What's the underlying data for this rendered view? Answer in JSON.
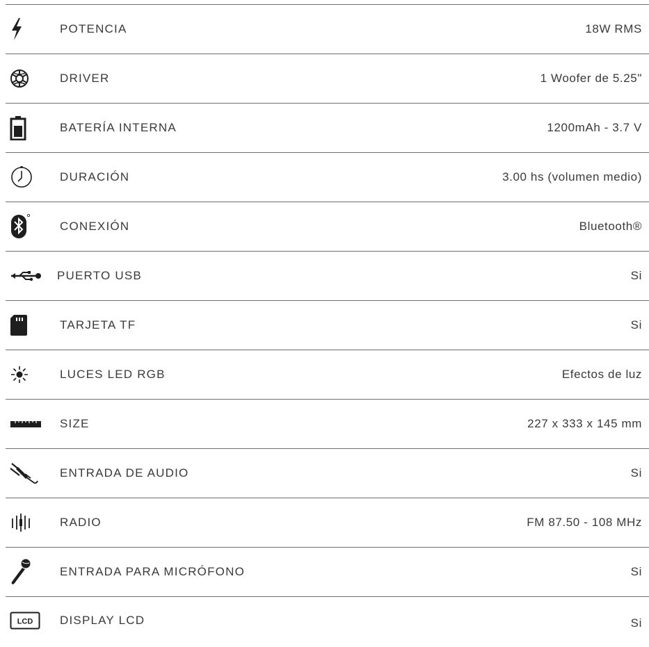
{
  "specs": [
    {
      "label": "POTENCIA",
      "value": "18W RMS",
      "icon": "lightning-bolt-icon"
    },
    {
      "label": "DRIVER",
      "value": "1 Woofer de 5.25\"",
      "icon": "speaker-driver-icon"
    },
    {
      "label": "BATERÍA INTERNA",
      "value": "1200mAh - 3.7 V",
      "icon": "battery-icon"
    },
    {
      "label": "DURACIÓN",
      "value": "3.00 hs (volumen medio)",
      "icon": "clock-icon"
    },
    {
      "label": "CONEXIÓN",
      "value": "Bluetooth®",
      "icon": "bluetooth-icon"
    },
    {
      "label": "PUERTO USB",
      "value": "Si",
      "icon": "usb-icon"
    },
    {
      "label": "TARJETA TF",
      "value": "Si",
      "icon": "sd-card-icon"
    },
    {
      "label": "LUCES LED RGB",
      "value": "Efectos de luz",
      "icon": "light-burst-icon"
    },
    {
      "label": "SIZE",
      "value": "227 x 333 x 145 mm",
      "icon": "ruler-icon"
    },
    {
      "label": "ENTRADA DE AUDIO",
      "value": "Si",
      "icon": "audio-cable-icon"
    },
    {
      "label": "RADIO",
      "value": "FM 87.50 - 108 MHz",
      "icon": "radio-wave-icon"
    },
    {
      "label": "ENTRADA PARA MICRÓFONO",
      "value": "Si",
      "icon": "microphone-icon"
    },
    {
      "label": "DISPLAY LCD",
      "value": "Si",
      "icon": "lcd-display-icon",
      "icon_text": "LCD"
    }
  ],
  "colors": {
    "text": "#3a3a3a",
    "divider": "#6f6f6f",
    "icon": "#1e1e1e"
  }
}
